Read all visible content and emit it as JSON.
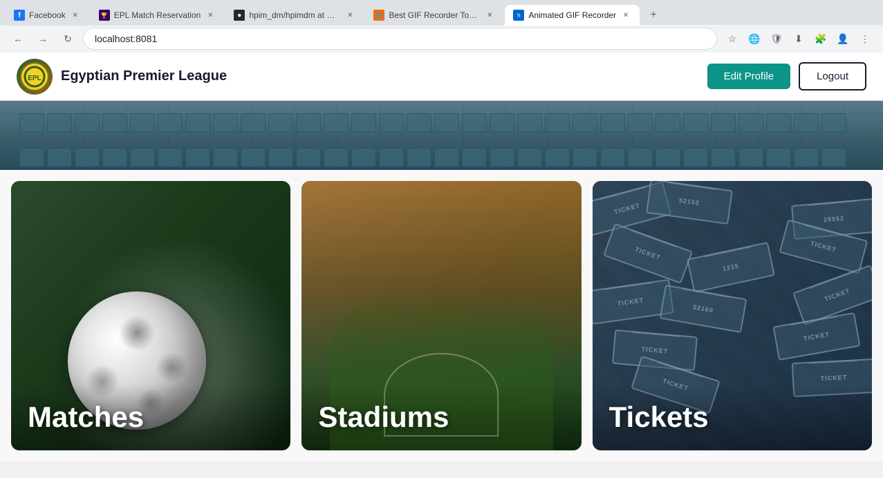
{
  "browser": {
    "url": "localhost:8081",
    "tabs": [
      {
        "id": "facebook",
        "title": "Facebook",
        "favicon": "F",
        "favicon_class": "tab-facebook",
        "active": false
      },
      {
        "id": "epl",
        "title": "EPL Match Reservation",
        "favicon": "E",
        "favicon_class": "tab-epl",
        "active": false
      },
      {
        "id": "github",
        "title": "hpim_dm/hpimdm at ma...",
        "favicon": "⚫",
        "favicon_class": "tab-github",
        "active": false
      },
      {
        "id": "gif",
        "title": "Best GIF Recorder Tools...",
        "favicon": "🎬",
        "favicon_class": "tab-gif",
        "active": false
      },
      {
        "id": "animated",
        "title": "Animated GIF Recorder",
        "favicon": "A",
        "favicon_class": "tab-animated",
        "active": true
      }
    ],
    "nav": {
      "back_title": "Back",
      "forward_title": "Forward",
      "refresh_title": "Refresh"
    }
  },
  "app": {
    "brand": {
      "name": "Egyptian Premier League",
      "logo_alt": "EPL Logo"
    },
    "navbar": {
      "edit_profile_label": "Edit Profile",
      "logout_label": "Logout"
    },
    "hero": {
      "alt": "Stadium seats background"
    },
    "cards": [
      {
        "id": "matches",
        "title": "Matches",
        "bg_class": "card-matches-bg",
        "alt": "Football match background"
      },
      {
        "id": "stadiums",
        "title": "Stadiums",
        "bg_class": "card-stadiums-bg",
        "alt": "Stadium background"
      },
      {
        "id": "tickets",
        "title": "Tickets",
        "bg_class": "card-tickets-bg",
        "alt": "Tickets background"
      }
    ]
  }
}
